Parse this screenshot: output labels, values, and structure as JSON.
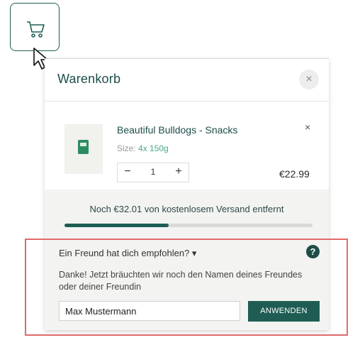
{
  "cart": {
    "title": "Warenkorb",
    "close_symbol": "×"
  },
  "item": {
    "name": "Beautiful Bulldogs - Snacks",
    "size_label": "Size:",
    "size_value": "4x 150g",
    "quantity": "1",
    "minus": "−",
    "plus": "+",
    "price": "€22.99",
    "remove_symbol": "×"
  },
  "shipping": {
    "text": "Noch €32.01 von kostenlosem Versand entfernt",
    "progress_fraction": 0.42
  },
  "referral": {
    "question": "Ein Freund hat dich empfohlen? ▾",
    "help_symbol": "?",
    "thanks": "Danke! Jetzt bräuchten wir noch den Namen deines Freundes oder deiner Freundin",
    "input_value": "Max Mustermann",
    "apply_label": "ANWENDEN"
  },
  "colors": {
    "brand": "#1f5d54",
    "highlight": "#e06969"
  }
}
